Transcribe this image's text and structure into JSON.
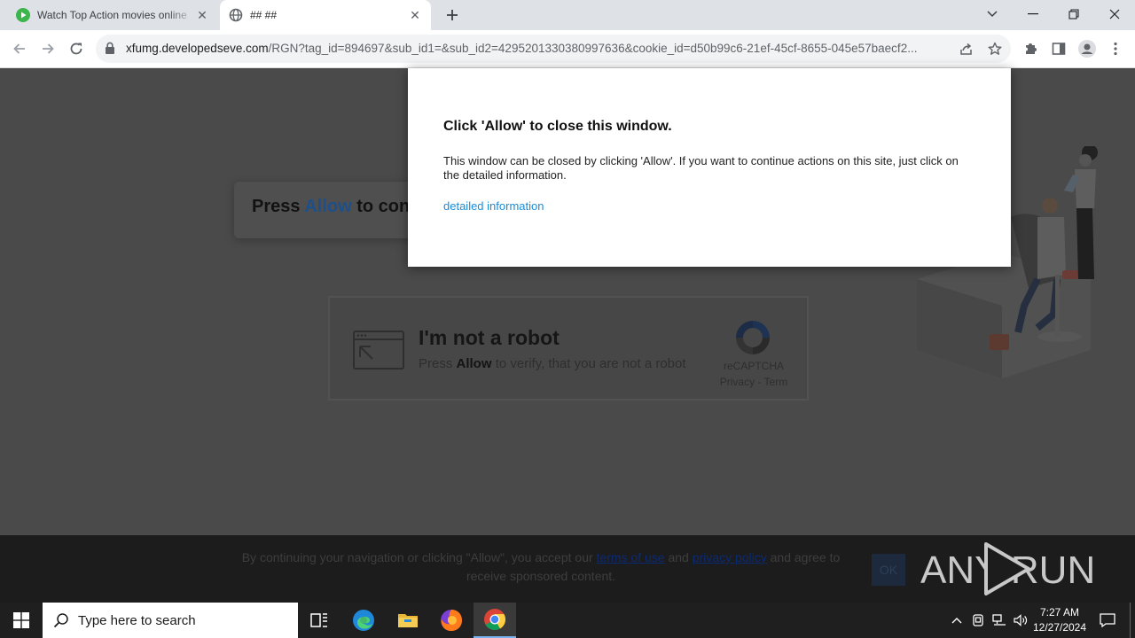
{
  "browser": {
    "tabs": [
      {
        "title": "Watch Top Action movies online",
        "active": false
      },
      {
        "title": "## ##",
        "active": true
      }
    ],
    "url_host": "xfumg.developedseve.com",
    "url_path": "/RGN?tag_id=894697&sub_id1=&sub_id2=4295201330380997636&cookie_id=d50b99c6-21ef-45cf-8655-045e57baecf2..."
  },
  "page": {
    "press_prefix": "Press",
    "press_allow": "Allow",
    "press_suffix": "to con",
    "captcha": {
      "title": "I'm not a robot",
      "sub_prefix": "Press",
      "sub_allow": "Allow",
      "sub_suffix": "to verify, that you are not a robot",
      "brand": "reCAPTCHA",
      "links": "Privacy - Term"
    }
  },
  "popup": {
    "title": "Click 'Allow' to close this window.",
    "body": "This window can be closed by clicking 'Allow'. If you want to continue actions on this site, just click on the detailed information.",
    "link": "detailed information"
  },
  "banner": {
    "text_1": "By continuing your navigation or clicking \"Allow\", you accept our",
    "terms": "terms of use",
    "and": "and",
    "privacy": "privacy policy",
    "text_2": "and agree to receive sponsored content.",
    "ok": "OK",
    "watermark": "ANY RUN"
  },
  "taskbar": {
    "search_placeholder": "Type here to search",
    "time": "7:27 AM",
    "date": "12/27/2024"
  },
  "colors": {
    "tabstrip": "#dee1e6",
    "page_dim": "#4a4a4a",
    "link_blue": "#1a8cd8",
    "taskbar": "#1f1f1f"
  }
}
